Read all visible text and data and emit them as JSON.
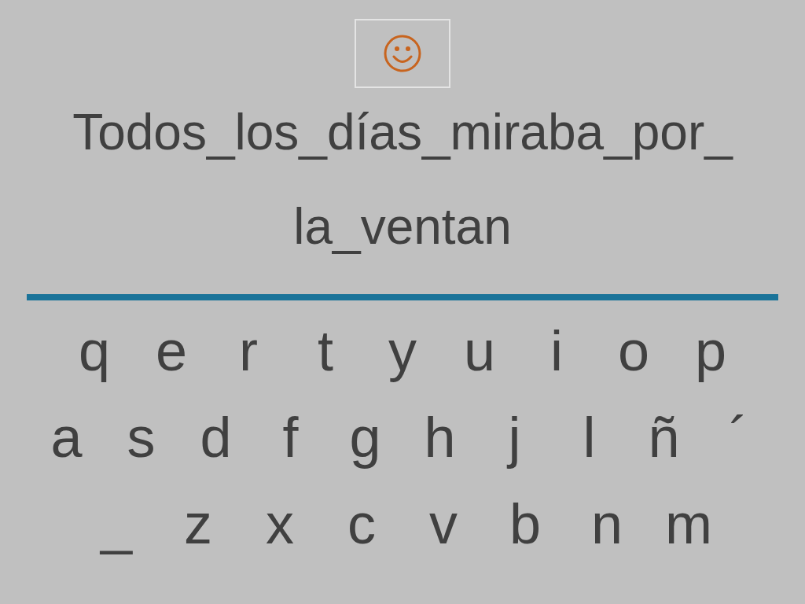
{
  "sentence_lines": [
    "Todos_los_días_miraba_por_",
    "la_ventan"
  ],
  "keyboard_rows": [
    [
      "q",
      "e",
      "r",
      "t",
      "y",
      "u",
      "i",
      "o",
      "p"
    ],
    [
      "a",
      "s",
      "d",
      "f",
      "g",
      "h",
      "j",
      "l",
      "ñ",
      "´"
    ],
    [
      "_",
      "z",
      "x",
      "c",
      "v",
      "b",
      "n",
      "m"
    ]
  ]
}
